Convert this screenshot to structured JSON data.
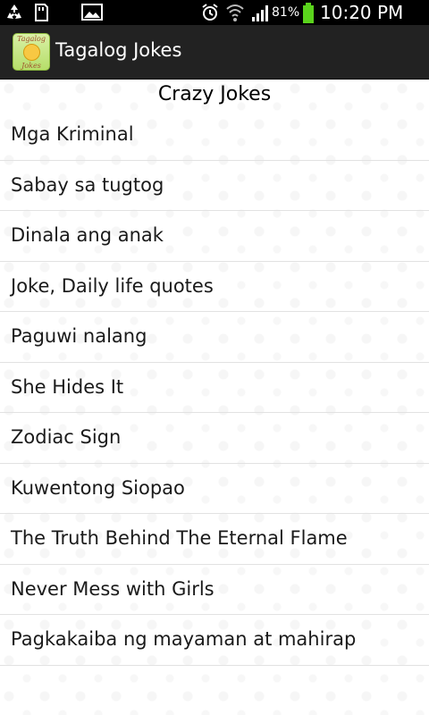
{
  "status_bar": {
    "battery_percent": "81%",
    "time": "10:20 PM",
    "icons": [
      "recycle-icon",
      "sd-card-icon",
      "image-icon",
      "alarm-icon",
      "wifi-icon",
      "signal-icon",
      "battery-icon"
    ]
  },
  "action_bar": {
    "app_title": "Tagalog Jokes",
    "app_icon_label_top": "Tagalog",
    "app_icon_label_bottom": "Jokes"
  },
  "content": {
    "category_title": "Crazy Jokes",
    "jokes": [
      "Mga Kriminal",
      "Sabay sa tugtog",
      "Dinala ang anak",
      "Joke, Daily life quotes",
      "Paguwi nalang",
      "She Hides It",
      "Zodiac Sign",
      "Kuwentong Siopao",
      "The Truth Behind The Eternal Flame",
      "Never Mess with Girls",
      "Pagkakaiba ng mayaman at mahirap"
    ]
  },
  "colors": {
    "status_bar_bg": "#000000",
    "action_bar_bg": "#222222",
    "battery_green": "#5ad31c",
    "text_primary": "#1a1a1a"
  }
}
